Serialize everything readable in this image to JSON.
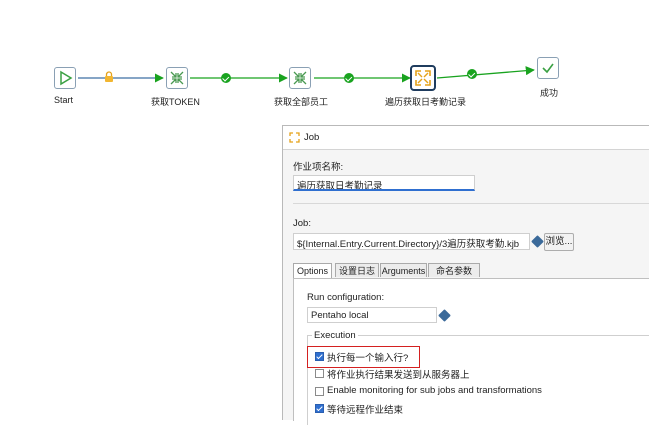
{
  "canvas": {
    "nodes": [
      {
        "id": "start",
        "label": "Start",
        "icon": "start-play-icon"
      },
      {
        "id": "token",
        "label": "获取TOKEN",
        "icon": "transformation-icon"
      },
      {
        "id": "staff",
        "label": "获取全部员工",
        "icon": "transformation-icon"
      },
      {
        "id": "attendance",
        "label": "遍历获取日考勤记录",
        "icon": "job-icon"
      },
      {
        "id": "success",
        "label": "成功",
        "icon": "success-check-icon"
      }
    ],
    "hops": {
      "lock_icon": "lock-icon",
      "ok_icon": "success-check-icon",
      "arrow_color": "#3e6fa3",
      "ok_color": "#19a31f"
    }
  },
  "dialog": {
    "title": "Job",
    "jobentry_name_label": "作业项名称:",
    "jobentry_name_value": "遍历获取日考勤记录",
    "job_label": "Job:",
    "job_path_value": "${Internal.Entry.Current.Directory}/3遍历获取考勤.kjb",
    "browse_label": "浏览...",
    "tabs": [
      "Options",
      "设置日志",
      "Arguments",
      "命名参数"
    ],
    "active_tab": "Options",
    "run_config_label": "Run configuration:",
    "run_config_value": "Pentaho local",
    "execution_group_label": "Execution",
    "options": [
      {
        "label": "执行每一个输入行?",
        "checked": true,
        "highlighted": true
      },
      {
        "label": "将作业执行结果发送到从服务器上",
        "checked": false,
        "highlighted": false
      },
      {
        "label": "Enable monitoring for sub jobs and transformations",
        "checked": false,
        "highlighted": false
      },
      {
        "label": "等待远程作业结束",
        "checked": true,
        "highlighted": false
      }
    ],
    "highlight_color": "#d42020"
  }
}
